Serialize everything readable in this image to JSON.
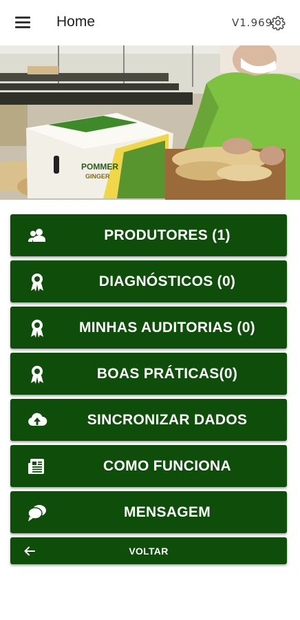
{
  "appbar": {
    "title": "Home",
    "version": "V1.969",
    "menu_icon": "menu-icon",
    "settings_icon": "gear-icon"
  },
  "hero": {
    "box_brand": "POMMER",
    "box_brand_sub": "GINGER"
  },
  "menu": {
    "produtores": "PRODUTORES (1)",
    "diagnosticos": "DIAGNÓSTICOS (0)",
    "auditorias": "MINHAS AUDITORIAS (0)",
    "boas_praticas": "BOAS PRÁTICAS(0)",
    "sincronizar": "SINCRONIZAR DADOS",
    "como_funciona": "COMO FUNCIONA",
    "mensagem": "MENSAGEM",
    "voltar": "VOLTAR"
  },
  "colors": {
    "button_bg": "#0f4d0a",
    "button_text": "#ffffff",
    "appbar_bg": "#ffffff"
  }
}
